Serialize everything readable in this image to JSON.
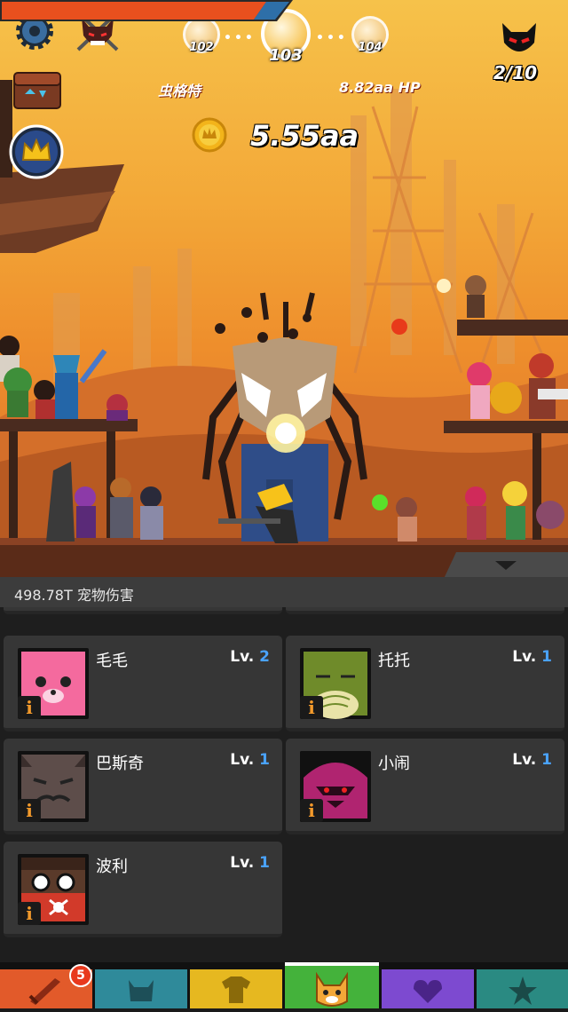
{
  "stages": {
    "prev": "102",
    "current": "103",
    "next": "104"
  },
  "boss": {
    "name": "虫格特",
    "hp": "8.82aa HP",
    "hp_fraction": 0.92
  },
  "gold": "5.55aa",
  "boss_counter": "2/10",
  "pet_damage": "498.78T 宠物伤害",
  "pets": [
    {
      "name": "毛毛",
      "lv_prefix": "Lv. ",
      "lv": "2",
      "color": "#f46a9e"
    },
    {
      "name": "托托",
      "lv_prefix": "Lv. ",
      "lv": "1",
      "color": "#6f8b2a"
    },
    {
      "name": "巴斯奇",
      "lv_prefix": "Lv. ",
      "lv": "1",
      "color": "#5d4d4a"
    },
    {
      "name": "小闹",
      "lv_prefix": "Lv. ",
      "lv": "1",
      "color": "#b02470"
    },
    {
      "name": "波利",
      "lv_prefix": "Lv. ",
      "lv": "1",
      "color": "#5a3a2a"
    }
  ],
  "tabs": [
    {
      "icon": "sword-icon",
      "color": "#e25a2a"
    },
    {
      "icon": "viking-helmet-icon",
      "color": "#2f8a9a"
    },
    {
      "icon": "shirt-icon",
      "color": "#e6b820"
    },
    {
      "icon": "pet-fox-icon",
      "color": "#44b23b"
    },
    {
      "icon": "heart-shield-icon",
      "color": "#7d4ad0"
    },
    {
      "icon": "star-icon",
      "color": "#2a8a82"
    }
  ],
  "sword_badge": "5"
}
